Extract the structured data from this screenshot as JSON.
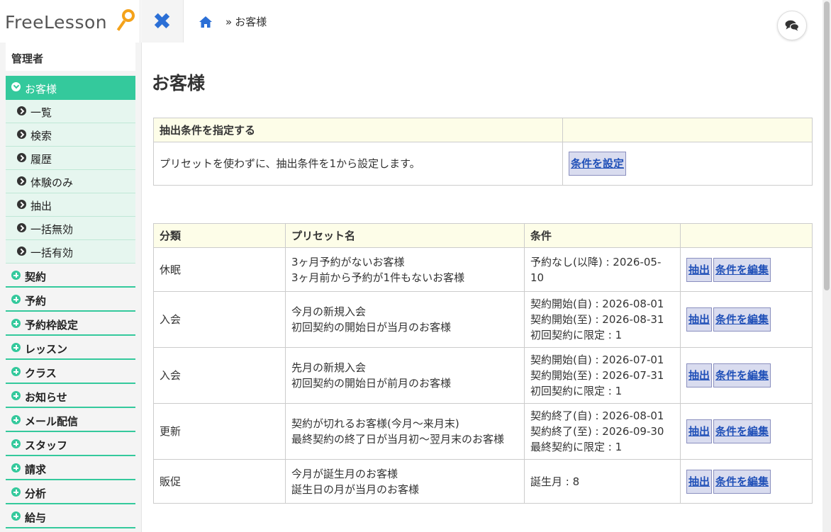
{
  "app": {
    "logo_text": "FreeLesson"
  },
  "breadcrumb": {
    "sep": "»",
    "current": "お客様"
  },
  "sidebar": {
    "role": "管理者",
    "active_section": "お客様",
    "sub_items": [
      "一覧",
      "検索",
      "履歴",
      "体験のみ",
      "抽出",
      "一括無効",
      "一括有効"
    ],
    "sections": [
      "契約",
      "予約",
      "予約枠設定",
      "レッスン",
      "クラス",
      "お知らせ",
      "メール配信",
      "スタッフ",
      "請求",
      "分析",
      "給与"
    ]
  },
  "page": {
    "title": "お客様",
    "condition_table": {
      "header": "抽出条件を指定する",
      "description": "プリセットを使わずに、抽出条件を1から設定します。",
      "button": "条件を設定"
    },
    "preset_table": {
      "headers": [
        "分類",
        "プリセット名",
        "条件",
        ""
      ],
      "extract_label": "抽出",
      "edit_label": "条件を編集",
      "rows": [
        {
          "category": "休眠",
          "name_line1": "3ヶ月予約がないお客様",
          "name_line2": "3ヶ月前から予約が1件もないお客様",
          "cond_line1": "予約なし(以降) : 2026-05-10",
          "cond_line2": "",
          "cond_line3": ""
        },
        {
          "category": "入会",
          "name_line1": "今月の新規入会",
          "name_line2": "初回契約の開始日が当月のお客様",
          "cond_line1": "契約開始(自) : 2026-08-01",
          "cond_line2": "契約開始(至) : 2026-08-31",
          "cond_line3": "初回契約に限定 : 1"
        },
        {
          "category": "入会",
          "name_line1": "先月の新規入会",
          "name_line2": "初回契約の開始日が前月のお客様",
          "cond_line1": "契約開始(自) : 2026-07-01",
          "cond_line2": "契約開始(至) : 2026-07-31",
          "cond_line3": "初回契約に限定 : 1"
        },
        {
          "category": "更新",
          "name_line1": "契約が切れるお客様(今月～来月末)",
          "name_line2": "最終契約の終了日が当月初～翌月末のお客様",
          "cond_line1": "契約終了(自) : 2026-08-01",
          "cond_line2": "契約終了(至) : 2026-09-30",
          "cond_line3": "最終契約に限定 : 1"
        },
        {
          "category": "販促",
          "name_line1": "今月が誕生月のお客様",
          "name_line2": "誕生日の月が当月のお客様",
          "cond_line1": "誕生月 : 8",
          "cond_line2": "",
          "cond_line3": ""
        }
      ]
    }
  },
  "icons": {
    "close": "close-icon",
    "home": "home-icon",
    "chat": "chat-icon",
    "sub_item": "circle-arrow-right-icon",
    "active": "circle-arrow-down-icon",
    "section": "circle-plus-icon"
  },
  "colors": {
    "accent": "#34c99c",
    "link": "#2050b8",
    "close": "#2b6fd6",
    "logo_pin": "#f4a21a"
  }
}
